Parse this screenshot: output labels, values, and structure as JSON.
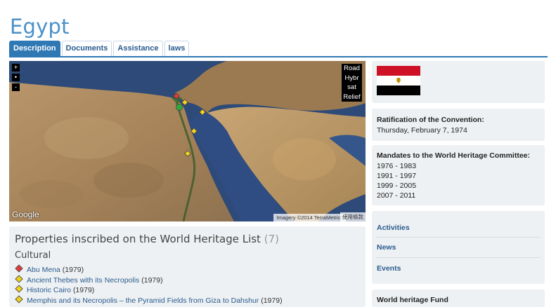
{
  "page_title": "Egypt",
  "tabs": [
    {
      "label": "Description"
    },
    {
      "label": "Documents"
    },
    {
      "label": "Assistance"
    },
    {
      "label": "laws"
    }
  ],
  "map": {
    "zoom_in": "+",
    "zoom_center": "•",
    "zoom_out": "-",
    "layers": [
      "Road",
      "Hybr",
      "sat",
      "Relief"
    ],
    "logo": "Google",
    "attribution": "Imagery ©2014 TerraMetrics",
    "terms": "使用條款",
    "colors": {
      "sea": "#2c4a7a",
      "desert": "#a88860",
      "red_marker": "#e53935",
      "yellow_marker": "#f3d21b",
      "green_marker": "#2eaa3c"
    }
  },
  "properties": {
    "title": "Properties inscribed on the World Heritage List",
    "count": "(7)",
    "category": "Cultural",
    "items": [
      {
        "name": "Abu Mena",
        "year": "(1979)",
        "marker": "red"
      },
      {
        "name": "Ancient Thebes with its Necropolis",
        "year": "(1979)",
        "marker": "yellow"
      },
      {
        "name": "Historic Cairo",
        "year": "(1979)",
        "marker": "yellow"
      },
      {
        "name": "Memphis and its Necropolis – the Pyramid Fields from Giza to Dahshur",
        "year": "(1979)",
        "marker": "yellow"
      }
    ]
  },
  "sidebar": {
    "flag_colors": [
      "#ce1126",
      "#ffffff",
      "#000000"
    ],
    "ratification": {
      "label": "Ratification of the Convention:",
      "value": "Thursday, February 7, 1974"
    },
    "mandates": {
      "label": "Mandates to the World Heritage Committee:",
      "periods": [
        "1976 - 1983",
        "1991 - 1997",
        "1999 - 2005",
        "2007 - 2011"
      ]
    },
    "links": [
      "Activities",
      "News",
      "Events"
    ],
    "fund": {
      "label": "World heritage Fund"
    }
  }
}
